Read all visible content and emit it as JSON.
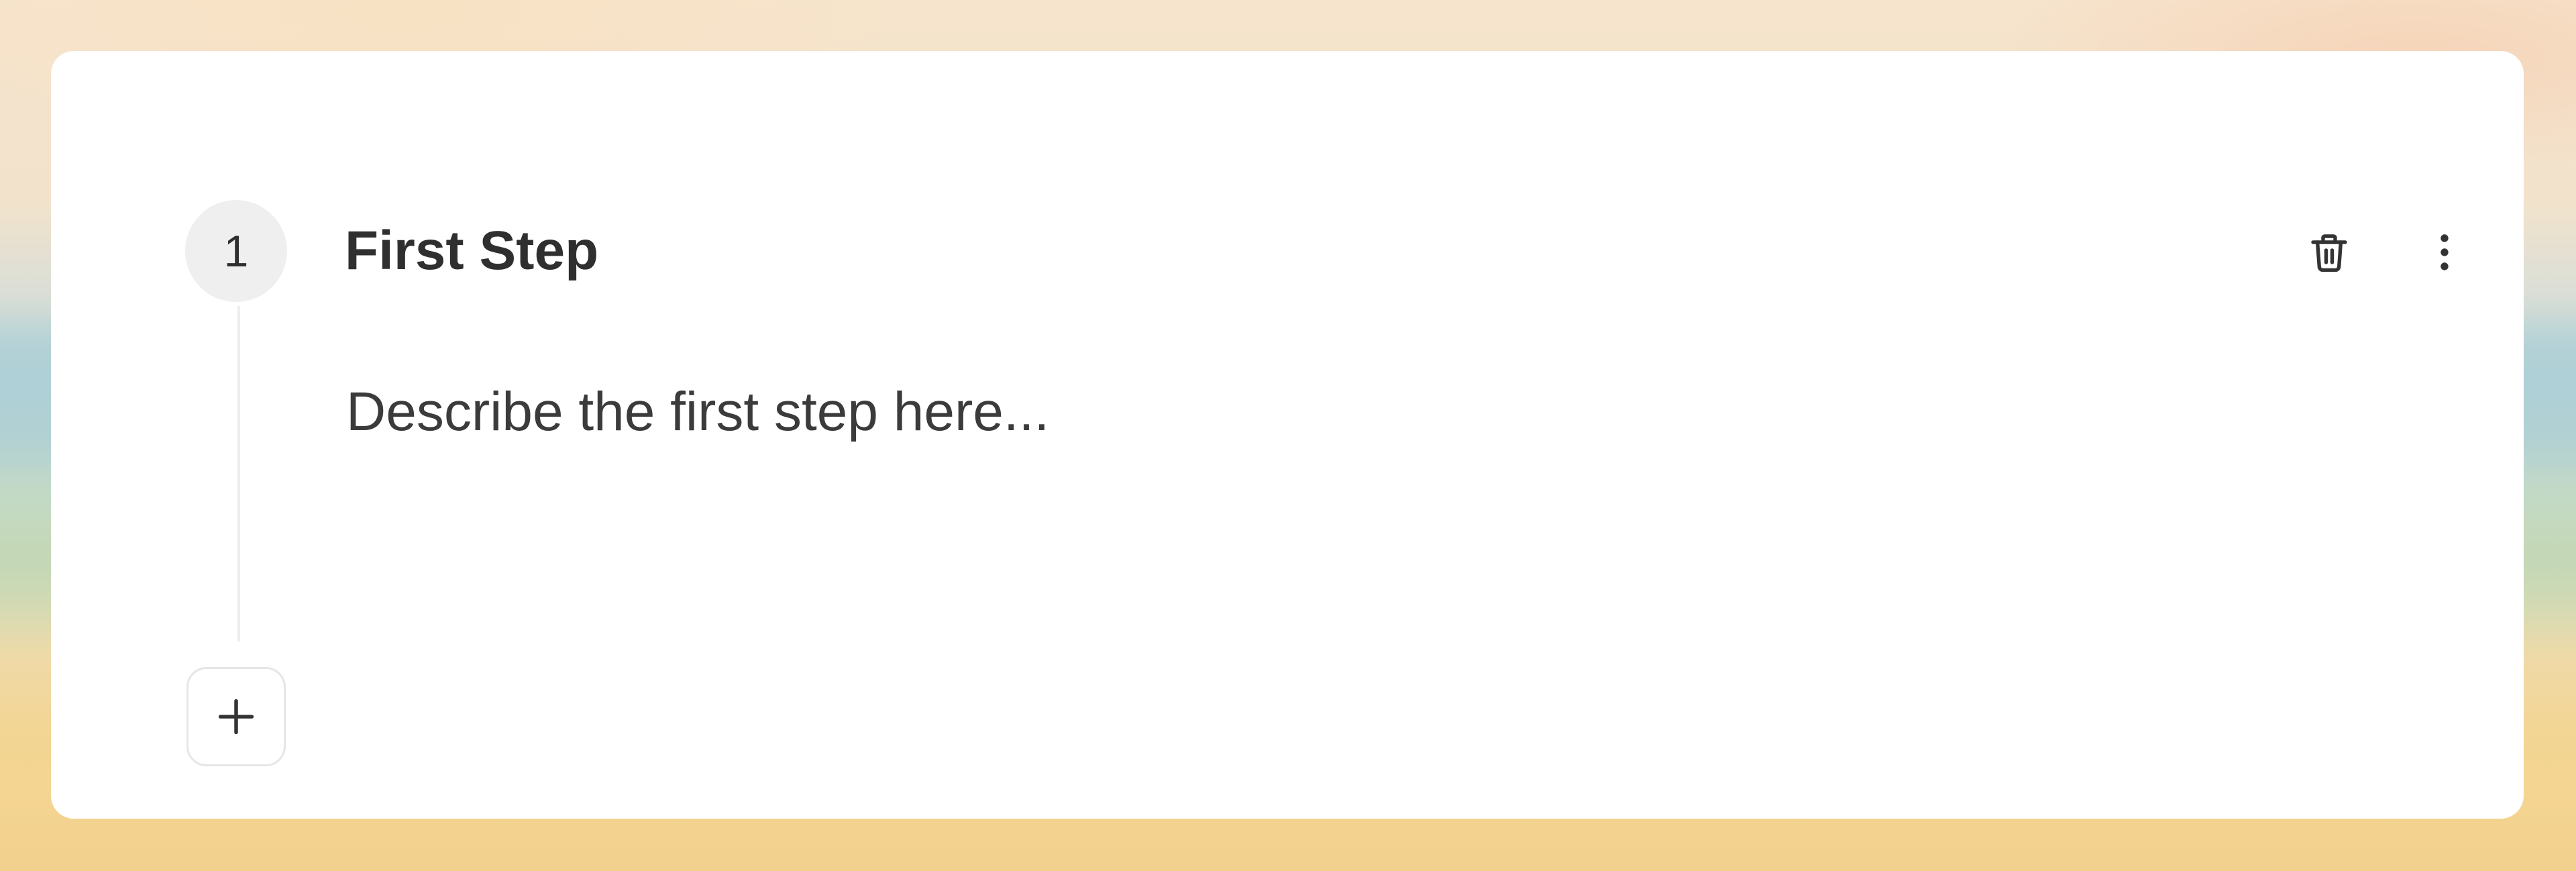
{
  "step": {
    "number": "1",
    "title": "First Step",
    "description": "Describe the first step here..."
  },
  "actions": {
    "delete_icon": "trash-icon",
    "menu_icon": "more-vertical-icon",
    "add_icon": "plus-icon"
  },
  "colors": {
    "card_background": "#ffffff",
    "step_badge_background": "#efefef",
    "text_primary": "#2f2f2f",
    "border": "#e6e6e6"
  }
}
